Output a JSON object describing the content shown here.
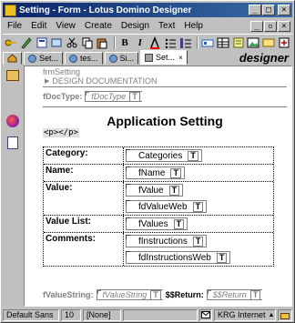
{
  "window": {
    "title": "Setting - Form - Lotus Domino Designer",
    "caption_min": "_",
    "caption_max": "□",
    "caption_close": "×"
  },
  "menu": {
    "items": [
      "File",
      "Edit",
      "View",
      "Create",
      "Design",
      "Text",
      "Help"
    ],
    "mdi_min": "_",
    "mdi_restore": "▫",
    "mdi_close": "×"
  },
  "toolbar": {
    "bold": "B",
    "italic": "I"
  },
  "tabs": [
    {
      "label": "",
      "active": false
    },
    {
      "label": "Set...",
      "active": false
    },
    {
      "label": "tes...",
      "active": false
    },
    {
      "label": "Si...",
      "active": false
    },
    {
      "label": "Set...",
      "active": true
    }
  ],
  "brand": "designer",
  "doc": {
    "form_name": "frmSetting",
    "design_doc_label": "DESIGN DOCUMENTATION",
    "fdoctype_label": "fDocType:",
    "fdoctype_field": "fDocType",
    "field_type_glyph": "T",
    "title": "Application Setting",
    "p_tag": "<p></p>",
    "table": [
      {
        "label": "Category:",
        "fields": [
          "Categories"
        ]
      },
      {
        "label": "Name:",
        "fields": [
          "fName"
        ]
      },
      {
        "label": "Value:",
        "fields": [
          "fValue",
          "fdValueWeb"
        ]
      },
      {
        "label": "Value List:",
        "fields": [
          "fValues"
        ]
      },
      {
        "label": "Comments:",
        "fields": [
          "fInstructions",
          "fdInstructionsWeb"
        ]
      }
    ],
    "bottom": {
      "fvaluestring_label": "fValueString:",
      "fvaluestring_field": "fValueString",
      "return_label": "$$Return:",
      "return_field": "$$Return"
    }
  },
  "status": {
    "font": "Default Sans",
    "size": "10",
    "style": "[None]",
    "location": "KRG Internet"
  }
}
